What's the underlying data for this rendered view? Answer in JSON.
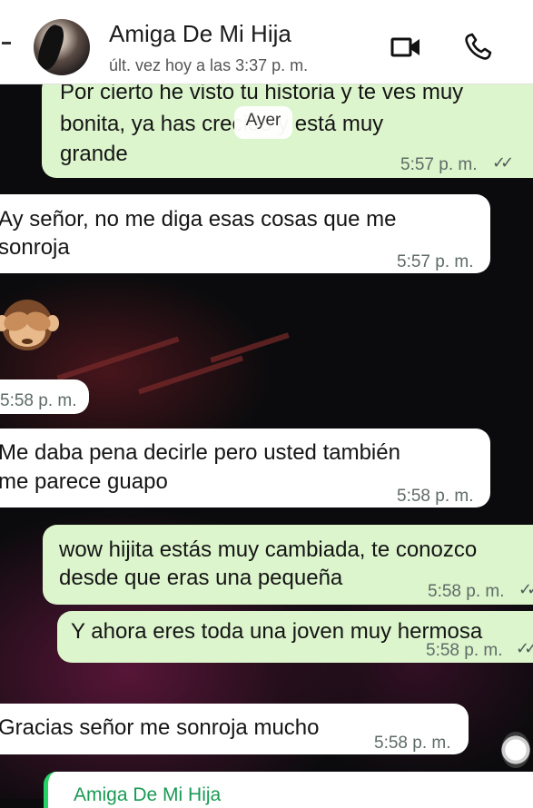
{
  "header": {
    "contact_name": "Amiga De Mi Hija",
    "status": "últ. vez hoy a las 3:37 p. m."
  },
  "date_chip": "Ayer",
  "messages": [
    {
      "dir": "out",
      "lines": [
        "Por cierto he visto tu historia y te ves muy",
        "bonita, ya has crecido y está muy",
        "grande"
      ],
      "time": "5:57 p. m.",
      "ticks": "✓✓"
    },
    {
      "dir": "in",
      "lines": [
        "Ay señor, no me diga esas cosas que me",
        "sonroja"
      ],
      "time": "5:57 p. m."
    },
    {
      "dir": "in",
      "emoji": "see-no-evil-monkey",
      "time": "5:58 p. m."
    },
    {
      "dir": "in",
      "lines": [
        "Me daba pena decirle pero usted también",
        "me parece guapo"
      ],
      "time": "5:58 p. m."
    },
    {
      "dir": "out",
      "lines": [
        "wow hijita estás muy cambiada, te conozco",
        "desde que eras una pequeña"
      ],
      "time": "5:58 p. m.",
      "ticks": "✓✓"
    },
    {
      "dir": "out",
      "lines": [
        "Y ahora eres toda una joven muy hermosa"
      ],
      "time": "5:58 p. m.",
      "ticks": "✓✓"
    },
    {
      "dir": "in",
      "lines": [
        "Gracias señor me sonroja mucho"
      ],
      "time": "5:58 p. m."
    }
  ],
  "reply_preview": {
    "name": "Amiga De Mi Hija"
  },
  "colors": {
    "outgoing": "#dcf5cc",
    "incoming": "#ffffff",
    "accent": "#25d366"
  },
  "icons": [
    "back-icon",
    "video-call-icon",
    "phone-call-icon",
    "see-no-evil-monkey-icon"
  ]
}
